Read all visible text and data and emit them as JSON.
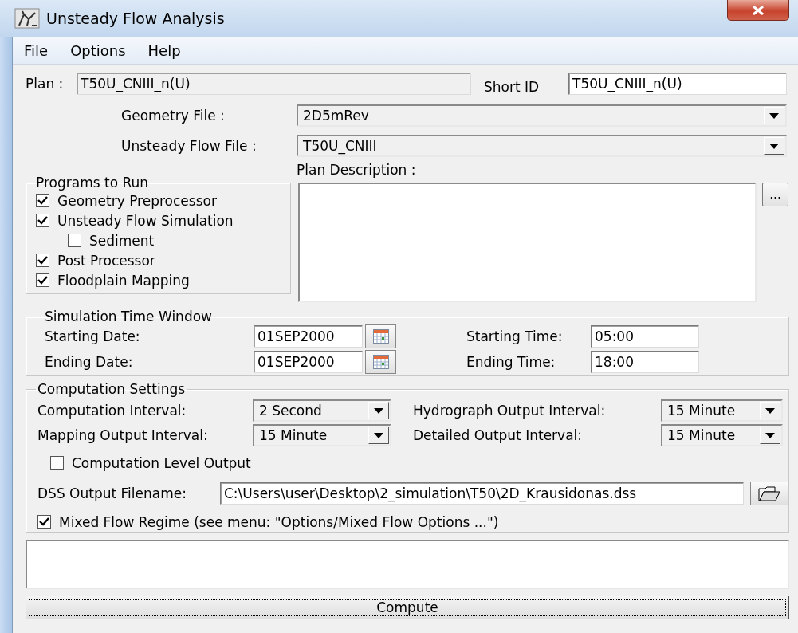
{
  "window": {
    "title": "Unsteady Flow Analysis"
  },
  "menu": [
    {
      "label": "File"
    },
    {
      "label": "Options"
    },
    {
      "label": "Help"
    }
  ],
  "plan": {
    "label": "Plan :",
    "value": "T50U_CNIII_n(U)",
    "disabled": true
  },
  "short_id": {
    "label": "Short ID",
    "value": "T50U_CNIII_n(U)",
    "disabled": false
  },
  "files": [
    {
      "label": "Geometry File :",
      "value": "2D5mRev"
    },
    {
      "label": "Unsteady Flow File :",
      "value": "T50U_CNIII"
    }
  ],
  "plan_description": {
    "label": "Plan Description :",
    "button": "..."
  },
  "programs_to_run": {
    "title": "Programs to Run",
    "items": [
      {
        "label": "Geometry Preprocessor",
        "checked": true
      },
      {
        "label": "Unsteady Flow Simulation",
        "checked": true,
        "children": [
          {
            "label": "Sediment",
            "checked": false
          }
        ]
      },
      {
        "label": "Post Processor",
        "checked": true
      },
      {
        "label": "Floodplain Mapping",
        "checked": true
      }
    ]
  },
  "simulation_time_window": {
    "title": "Simulation Time Window",
    "rows": [
      {
        "date_label": "Starting Date:",
        "date": "01SEP2000",
        "time_label": "Starting Time:",
        "time": "05:00"
      },
      {
        "date_label": "Ending Date:",
        "date": "01SEP2000",
        "time_label": "Ending Time:",
        "time": "18:00"
      }
    ]
  },
  "computation_settings": {
    "title": "Computation Settings",
    "intervals": [
      {
        "label": "Computation Interval:",
        "value": "2 Second"
      },
      {
        "label": "Hydrograph Output Interval:",
        "value": "15 Minute"
      },
      {
        "label": "Mapping Output Interval:",
        "value": "15 Minute"
      },
      {
        "label": "Detailed Output Interval:",
        "value": "15 Minute"
      }
    ],
    "computation_level_output": {
      "label": "Computation Level Output",
      "checked": false
    },
    "dss_output": {
      "label": "DSS Output Filename:",
      "value": "C:\\Users\\user\\Desktop\\2_simulation\\T50\\2D_Krausidonas.dss"
    },
    "mixed_flow": {
      "label": "Mixed Flow Regime (see menu: \"Options/Mixed Flow Options ...\")",
      "checked": true
    }
  },
  "compute_button": {
    "label": "Compute"
  }
}
